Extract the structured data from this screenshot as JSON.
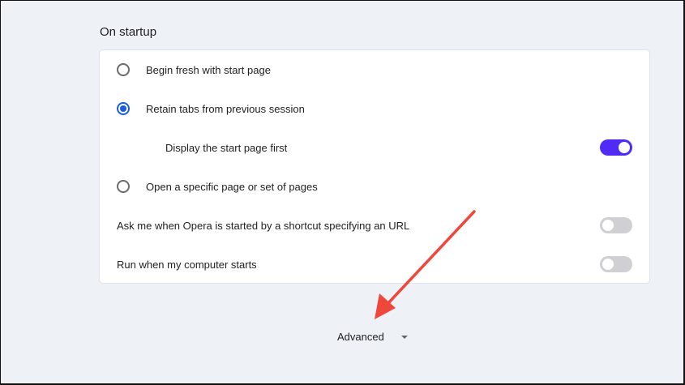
{
  "section_title": "On startup",
  "options": [
    {
      "label": "Begin fresh with start page",
      "selected": false
    },
    {
      "label": "Retain tabs from previous session",
      "selected": true
    },
    {
      "label": "Open a specific page or set of pages",
      "selected": false
    }
  ],
  "sub_option": {
    "label": "Display the start page first",
    "enabled": true
  },
  "toggles": [
    {
      "label": "Ask me when Opera is started by a shortcut specifying an URL",
      "enabled": false
    },
    {
      "label": "Run when my computer starts",
      "enabled": false
    }
  ],
  "advanced_label": "Advanced",
  "colors": {
    "accent": "#4f2bf5",
    "radio": "#1a5fd6",
    "annotation": "#f0473c"
  }
}
